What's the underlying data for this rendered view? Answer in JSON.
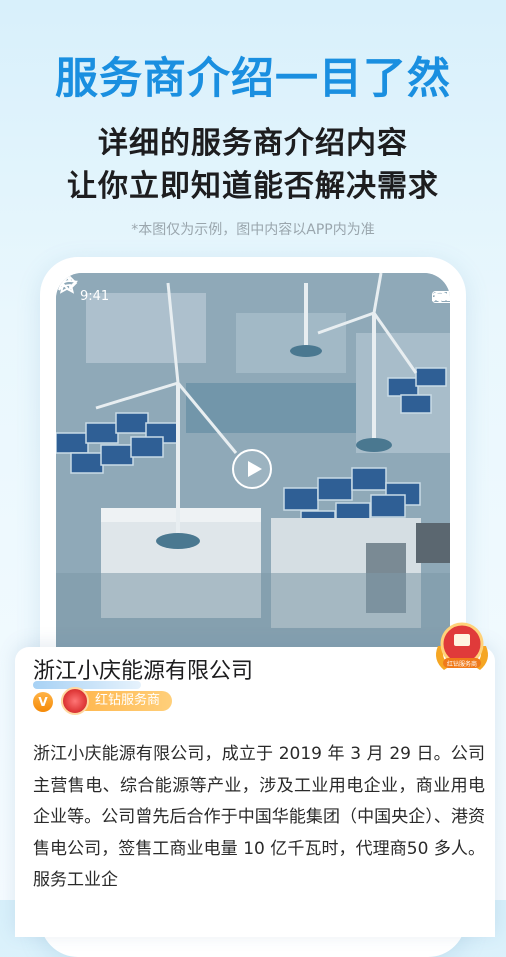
{
  "headline": "服务商介绍一目了然",
  "subtitle_line1": "详细的服务商介绍内容",
  "subtitle_line2": "让你立即知道能否解决需求",
  "disclaimer": "*本图仅为示例，图中内容以APP内为准",
  "phone": {
    "status_time": "9:41",
    "icons": [
      "signal-icon",
      "wifi-icon",
      "battery-icon",
      "back-icon",
      "star-icon",
      "share-icon",
      "play-icon"
    ]
  },
  "company": {
    "name": "浙江小庆能源有限公司",
    "v_label": "V",
    "tier_label": "红钻服务商",
    "medal_label": "红钻服务商",
    "description": "浙江小庆能源有限公司，成立于 2019 年 3 月 29 日。公司主营售电、综合能源等产业，涉及工业用电企业，商业用电企业等。公司曾先后合作于中国华能集团（中国央企）、港资售电公司，签售工商业电量 10 亿千瓦时，代理商50 多人。服务工业企"
  },
  "colors": {
    "accent": "#1a8fe0",
    "badge_orange": "#ffb347",
    "medal_red": "#e03a3a"
  }
}
